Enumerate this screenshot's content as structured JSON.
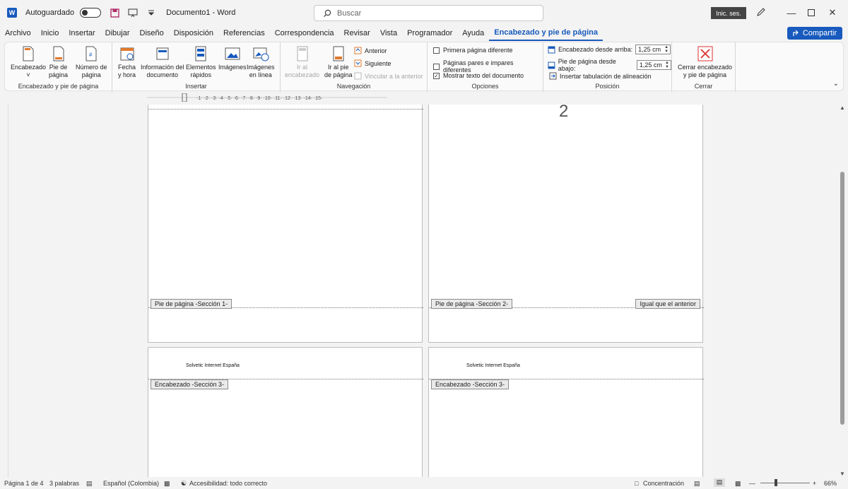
{
  "titlebar": {
    "autosave_label": "Autoguardado",
    "doc_title": "Documento1  -  Word",
    "search_placeholder": "Buscar",
    "signin_label": "Inic. ses."
  },
  "tabs": [
    "Archivo",
    "Inicio",
    "Insertar",
    "Dibujar",
    "Diseño",
    "Disposición",
    "Referencias",
    "Correspondencia",
    "Revisar",
    "Vista",
    "Programador",
    "Ayuda",
    "Encabezado y pie de página"
  ],
  "active_tab": "Encabezado y pie de página",
  "share_label": "Compartir",
  "ribbon": {
    "group1": {
      "label": "Encabezado y pie de página",
      "encabezado": "Encabezado",
      "pie_1": "Pie de",
      "pie_2": "página",
      "numero_1": "Número de",
      "numero_2": "página"
    },
    "group2": {
      "label": "Insertar",
      "fecha_1": "Fecha",
      "fecha_2": "y hora",
      "info_1": "Información del",
      "info_2": "documento",
      "elem_1": "Elementos",
      "elem_2": "rápidos",
      "imagenes": "Imágenes",
      "imglinea_1": "Imágenes",
      "imglinea_2": "en línea"
    },
    "group3": {
      "label": "Navegación",
      "iral_enc_1": "Ir al",
      "iral_enc_2": "encabezado",
      "iral_pie_1": "Ir al pie",
      "iral_pie_2": "de página",
      "anterior": "Anterior",
      "siguiente": "Siguiente",
      "vincular": "Vincular a la anterior"
    },
    "group4": {
      "label": "Opciones",
      "primera": "Primera página diferente",
      "pares": "Páginas pares e impares diferentes",
      "mostrar": "Mostrar texto del documento"
    },
    "group5": {
      "label": "Posición",
      "enc_arriba": "Encabezado desde arriba:",
      "enc_arriba_val": "1,25 cm",
      "pie_abajo": "Pie de página desde abajo:",
      "pie_abajo_val": "1,25 cm",
      "tabulacion": "Insertar tabulación de alineación"
    },
    "group6": {
      "label": "Cerrar",
      "cerrar_1": "Cerrar encabezado",
      "cerrar_2": "y pie de página"
    }
  },
  "document": {
    "page_number": "2",
    "footer_tag_1": "Pie de página -Sección 1-",
    "footer_tag_2": "Pie de página -Sección 2-",
    "same_as_previous": "Igual que el anterior",
    "header_text": "Solvetic Internet España",
    "header_tag_3a": "Encabezado -Sección 3-",
    "header_tag_3b": "Encabezado -Sección 3-"
  },
  "status": {
    "page": "Página 1 de 4",
    "words": "3 palabras",
    "language": "Español (Colombia)",
    "accessibility": "Accesibilidad: todo correcto",
    "focus": "Concentración",
    "zoom": "66%"
  },
  "colors": {
    "accent": "#185abd"
  }
}
